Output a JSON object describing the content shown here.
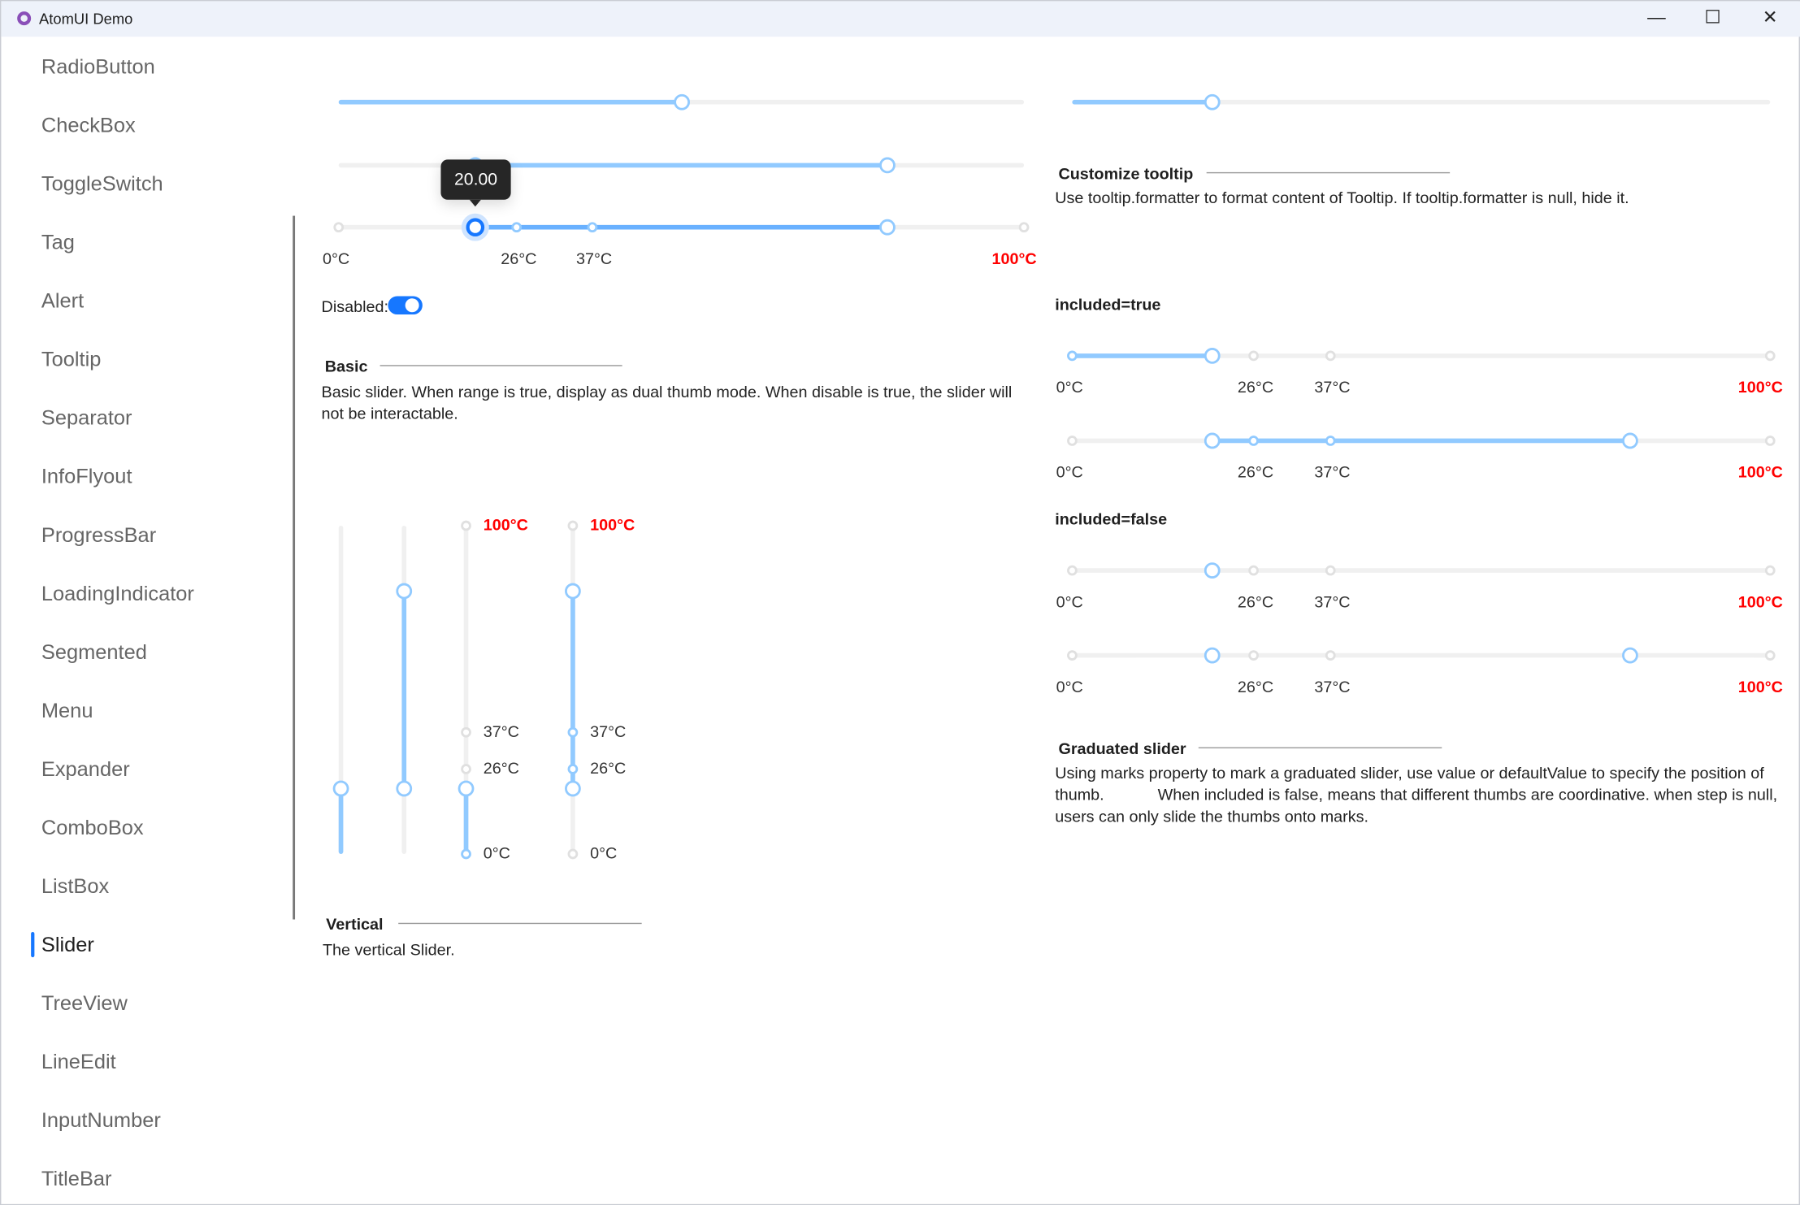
{
  "window": {
    "title": "AtomUI Demo",
    "minimize": "—",
    "maximize": "☐",
    "close": "✕"
  },
  "sidebar": {
    "items": [
      "RadioButton",
      "CheckBox",
      "ToggleSwitch",
      "Tag",
      "Alert",
      "Tooltip",
      "Separator",
      "InfoFlyout",
      "ProgressBar",
      "LoadingIndicator",
      "Segmented",
      "Menu",
      "Expander",
      "ComboBox",
      "ListBox",
      "Slider",
      "TreeView",
      "LineEdit",
      "InputNumber",
      "TitleBar"
    ],
    "selected": "Slider"
  },
  "marks": [
    "0°C",
    "26°C",
    "37°C",
    "100°C"
  ],
  "mark_values": [
    0,
    26,
    37,
    100
  ],
  "basic": {
    "title": "Basic",
    "description": "Basic slider. When range is true, display as dual thumb mode. When disable is true, the slider will not be interactable.",
    "disabled_label": "Disabled:",
    "disabled_on": true,
    "tooltip": "20.00",
    "sliders": [
      {
        "value": 50
      },
      {
        "range": [
          20,
          80
        ]
      },
      {
        "range": [
          20,
          80
        ],
        "marks": true,
        "active": true
      }
    ]
  },
  "vertical": {
    "title": "Vertical",
    "description": "The vertical Slider.",
    "sliders": [
      {
        "value": 20
      },
      {
        "range": [
          20,
          80
        ]
      },
      {
        "value": 20,
        "marks": true
      },
      {
        "range": [
          20,
          80
        ],
        "marks": true
      }
    ]
  },
  "customize": {
    "title": "Customize tooltip",
    "description": "Use tooltip.formatter to format content of Tooltip. If tooltip.formatter is null, hide it.",
    "slider": {
      "value": 20
    }
  },
  "graduated": {
    "title": "Graduated slider",
    "included_true": "included=true",
    "included_false": "included=false",
    "description": "Using marks property to mark a graduated slider, use value or defaultValue to specify the position of thumb.            When included is false, means that different thumbs are coordinative. when step is null, users can only slide the thumbs onto marks.",
    "sliders": [
      {
        "value": 20,
        "marks": true,
        "included": true
      },
      {
        "range": [
          20,
          80
        ],
        "marks": true,
        "included": true
      },
      {
        "value": 20,
        "marks": true,
        "included": false
      },
      {
        "range": [
          20,
          80
        ],
        "marks": true,
        "included": false
      }
    ]
  },
  "colors": {
    "accent": "#1677ff",
    "fill": "#91caff",
    "mark_hot": "#ff0000"
  }
}
